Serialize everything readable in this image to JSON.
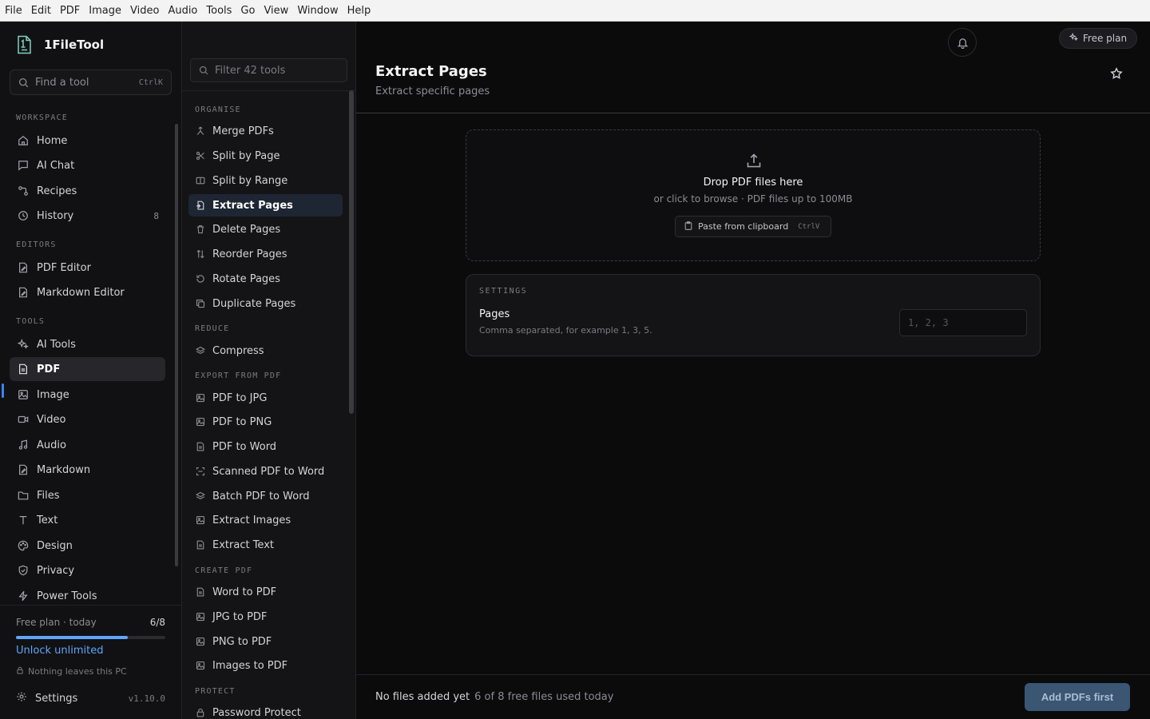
{
  "menubar": [
    "File",
    "Edit",
    "PDF",
    "Image",
    "Video",
    "Audio",
    "Tools",
    "Go",
    "View",
    "Window",
    "Help"
  ],
  "brand": {
    "name": "1FileTool"
  },
  "find": {
    "label": "Find a tool",
    "shortcut": "CtrlK"
  },
  "sidebar": {
    "sections": {
      "workspace": "WORKSPACE",
      "editors": "EDITORS",
      "tools": "TOOLS"
    },
    "workspace": [
      {
        "label": "Home",
        "icon": "home-icon"
      },
      {
        "label": "AI Chat",
        "icon": "chat-icon"
      },
      {
        "label": "Recipes",
        "icon": "recipes-icon"
      },
      {
        "label": "History",
        "icon": "history-icon",
        "count": "8"
      }
    ],
    "editors": [
      {
        "label": "PDF Editor",
        "icon": "pdf-editor-icon"
      },
      {
        "label": "Markdown Editor",
        "icon": "markdown-editor-icon"
      }
    ],
    "tools": [
      {
        "label": "AI Tools",
        "icon": "sparkles-icon"
      },
      {
        "label": "PDF",
        "icon": "pdf-icon",
        "active": true
      },
      {
        "label": "Image",
        "icon": "image-icon"
      },
      {
        "label": "Video",
        "icon": "video-icon"
      },
      {
        "label": "Audio",
        "icon": "audio-icon"
      },
      {
        "label": "Markdown",
        "icon": "markdown-icon"
      },
      {
        "label": "Files",
        "icon": "folder-icon"
      },
      {
        "label": "Text",
        "icon": "text-icon"
      },
      {
        "label": "Design",
        "icon": "palette-icon"
      },
      {
        "label": "Privacy",
        "icon": "shield-icon"
      },
      {
        "label": "Power Tools",
        "icon": "bolt-icon"
      }
    ],
    "footer": {
      "plan_label": "Free plan · today",
      "plan_count": "6/8",
      "plan_progress": 0.75,
      "unlock": "Unlock unlimited",
      "privacy_note": "Nothing leaves this PC",
      "settings": "Settings",
      "version": "v1.10.0"
    }
  },
  "tools_panel": {
    "filter_placeholder": "Filter 42 tools",
    "sections": [
      {
        "title": "ORGANISE",
        "items": [
          {
            "label": "Merge PDFs",
            "icon": "merge-icon"
          },
          {
            "label": "Split by Page",
            "icon": "scissors-icon"
          },
          {
            "label": "Split by Range",
            "icon": "split-range-icon"
          },
          {
            "label": "Extract Pages",
            "icon": "extract-pages-icon",
            "active": true
          },
          {
            "label": "Delete Pages",
            "icon": "trash-icon"
          },
          {
            "label": "Reorder Pages",
            "icon": "reorder-icon"
          },
          {
            "label": "Rotate Pages",
            "icon": "rotate-icon"
          },
          {
            "label": "Duplicate Pages",
            "icon": "duplicate-icon"
          }
        ]
      },
      {
        "title": "REDUCE",
        "items": [
          {
            "label": "Compress",
            "icon": "layers-icon"
          }
        ]
      },
      {
        "title": "EXPORT FROM PDF",
        "items": [
          {
            "label": "PDF to JPG",
            "icon": "image-icon"
          },
          {
            "label": "PDF to PNG",
            "icon": "image-icon"
          },
          {
            "label": "PDF to Word",
            "icon": "document-icon"
          },
          {
            "label": "Scanned PDF to Word",
            "icon": "scan-icon"
          },
          {
            "label": "Batch PDF to Word",
            "icon": "layers-icon"
          },
          {
            "label": "Extract Images",
            "icon": "images-icon"
          },
          {
            "label": "Extract Text",
            "icon": "document-icon"
          }
        ]
      },
      {
        "title": "CREATE PDF",
        "items": [
          {
            "label": "Word to PDF",
            "icon": "document-icon"
          },
          {
            "label": "JPG to PDF",
            "icon": "image-icon"
          },
          {
            "label": "PNG to PDF",
            "icon": "image-icon"
          },
          {
            "label": "Images to PDF",
            "icon": "images-icon"
          }
        ]
      },
      {
        "title": "PROTECT",
        "items": [
          {
            "label": "Password Protect",
            "icon": "lock-icon"
          }
        ]
      }
    ]
  },
  "header": {
    "free_plan": "Free plan",
    "title": "Extract Pages",
    "subtitle": "Extract specific pages"
  },
  "dropzone": {
    "title": "Drop PDF files here",
    "subtitle": "or click to browse · PDF files up to 100MB",
    "paste_label": "Paste from clipboard",
    "paste_shortcut": "CtrlV"
  },
  "settings": {
    "title": "SETTINGS",
    "pages_label": "Pages",
    "pages_help": "Comma separated, for example 1, 3, 5.",
    "pages_placeholder": "1, 2, 3",
    "pages_value": ""
  },
  "footer": {
    "status": "No files added yet",
    "usage": "6 of 8 free files used today",
    "action": "Add PDFs first"
  },
  "colors": {
    "accent": "#60a5fa",
    "active_indicator": "#3b82f6",
    "primary_disabled": "#3b5673",
    "background": "#0b0b0c"
  }
}
